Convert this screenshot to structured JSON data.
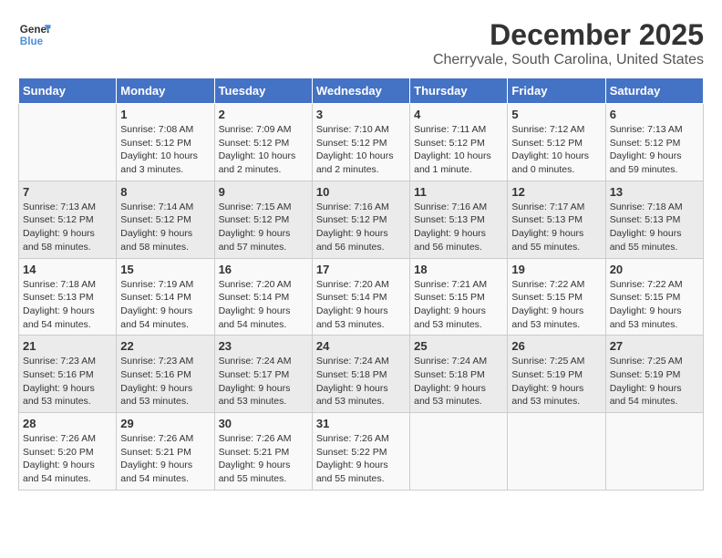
{
  "logo": {
    "line1": "General",
    "line2": "Blue"
  },
  "title": "December 2025",
  "subtitle": "Cherryvale, South Carolina, United States",
  "days_of_week": [
    "Sunday",
    "Monday",
    "Tuesday",
    "Wednesday",
    "Thursday",
    "Friday",
    "Saturday"
  ],
  "weeks": [
    [
      {
        "num": "",
        "detail": ""
      },
      {
        "num": "1",
        "detail": "Sunrise: 7:08 AM\nSunset: 5:12 PM\nDaylight: 10 hours\nand 3 minutes."
      },
      {
        "num": "2",
        "detail": "Sunrise: 7:09 AM\nSunset: 5:12 PM\nDaylight: 10 hours\nand 2 minutes."
      },
      {
        "num": "3",
        "detail": "Sunrise: 7:10 AM\nSunset: 5:12 PM\nDaylight: 10 hours\nand 2 minutes."
      },
      {
        "num": "4",
        "detail": "Sunrise: 7:11 AM\nSunset: 5:12 PM\nDaylight: 10 hours\nand 1 minute."
      },
      {
        "num": "5",
        "detail": "Sunrise: 7:12 AM\nSunset: 5:12 PM\nDaylight: 10 hours\nand 0 minutes."
      },
      {
        "num": "6",
        "detail": "Sunrise: 7:13 AM\nSunset: 5:12 PM\nDaylight: 9 hours\nand 59 minutes."
      }
    ],
    [
      {
        "num": "7",
        "detail": "Sunrise: 7:13 AM\nSunset: 5:12 PM\nDaylight: 9 hours\nand 58 minutes."
      },
      {
        "num": "8",
        "detail": "Sunrise: 7:14 AM\nSunset: 5:12 PM\nDaylight: 9 hours\nand 58 minutes."
      },
      {
        "num": "9",
        "detail": "Sunrise: 7:15 AM\nSunset: 5:12 PM\nDaylight: 9 hours\nand 57 minutes."
      },
      {
        "num": "10",
        "detail": "Sunrise: 7:16 AM\nSunset: 5:12 PM\nDaylight: 9 hours\nand 56 minutes."
      },
      {
        "num": "11",
        "detail": "Sunrise: 7:16 AM\nSunset: 5:13 PM\nDaylight: 9 hours\nand 56 minutes."
      },
      {
        "num": "12",
        "detail": "Sunrise: 7:17 AM\nSunset: 5:13 PM\nDaylight: 9 hours\nand 55 minutes."
      },
      {
        "num": "13",
        "detail": "Sunrise: 7:18 AM\nSunset: 5:13 PM\nDaylight: 9 hours\nand 55 minutes."
      }
    ],
    [
      {
        "num": "14",
        "detail": "Sunrise: 7:18 AM\nSunset: 5:13 PM\nDaylight: 9 hours\nand 54 minutes."
      },
      {
        "num": "15",
        "detail": "Sunrise: 7:19 AM\nSunset: 5:14 PM\nDaylight: 9 hours\nand 54 minutes."
      },
      {
        "num": "16",
        "detail": "Sunrise: 7:20 AM\nSunset: 5:14 PM\nDaylight: 9 hours\nand 54 minutes."
      },
      {
        "num": "17",
        "detail": "Sunrise: 7:20 AM\nSunset: 5:14 PM\nDaylight: 9 hours\nand 53 minutes."
      },
      {
        "num": "18",
        "detail": "Sunrise: 7:21 AM\nSunset: 5:15 PM\nDaylight: 9 hours\nand 53 minutes."
      },
      {
        "num": "19",
        "detail": "Sunrise: 7:22 AM\nSunset: 5:15 PM\nDaylight: 9 hours\nand 53 minutes."
      },
      {
        "num": "20",
        "detail": "Sunrise: 7:22 AM\nSunset: 5:15 PM\nDaylight: 9 hours\nand 53 minutes."
      }
    ],
    [
      {
        "num": "21",
        "detail": "Sunrise: 7:23 AM\nSunset: 5:16 PM\nDaylight: 9 hours\nand 53 minutes."
      },
      {
        "num": "22",
        "detail": "Sunrise: 7:23 AM\nSunset: 5:16 PM\nDaylight: 9 hours\nand 53 minutes."
      },
      {
        "num": "23",
        "detail": "Sunrise: 7:24 AM\nSunset: 5:17 PM\nDaylight: 9 hours\nand 53 minutes."
      },
      {
        "num": "24",
        "detail": "Sunrise: 7:24 AM\nSunset: 5:18 PM\nDaylight: 9 hours\nand 53 minutes."
      },
      {
        "num": "25",
        "detail": "Sunrise: 7:24 AM\nSunset: 5:18 PM\nDaylight: 9 hours\nand 53 minutes."
      },
      {
        "num": "26",
        "detail": "Sunrise: 7:25 AM\nSunset: 5:19 PM\nDaylight: 9 hours\nand 53 minutes."
      },
      {
        "num": "27",
        "detail": "Sunrise: 7:25 AM\nSunset: 5:19 PM\nDaylight: 9 hours\nand 54 minutes."
      }
    ],
    [
      {
        "num": "28",
        "detail": "Sunrise: 7:26 AM\nSunset: 5:20 PM\nDaylight: 9 hours\nand 54 minutes."
      },
      {
        "num": "29",
        "detail": "Sunrise: 7:26 AM\nSunset: 5:21 PM\nDaylight: 9 hours\nand 54 minutes."
      },
      {
        "num": "30",
        "detail": "Sunrise: 7:26 AM\nSunset: 5:21 PM\nDaylight: 9 hours\nand 55 minutes."
      },
      {
        "num": "31",
        "detail": "Sunrise: 7:26 AM\nSunset: 5:22 PM\nDaylight: 9 hours\nand 55 minutes."
      },
      {
        "num": "",
        "detail": ""
      },
      {
        "num": "",
        "detail": ""
      },
      {
        "num": "",
        "detail": ""
      }
    ]
  ]
}
